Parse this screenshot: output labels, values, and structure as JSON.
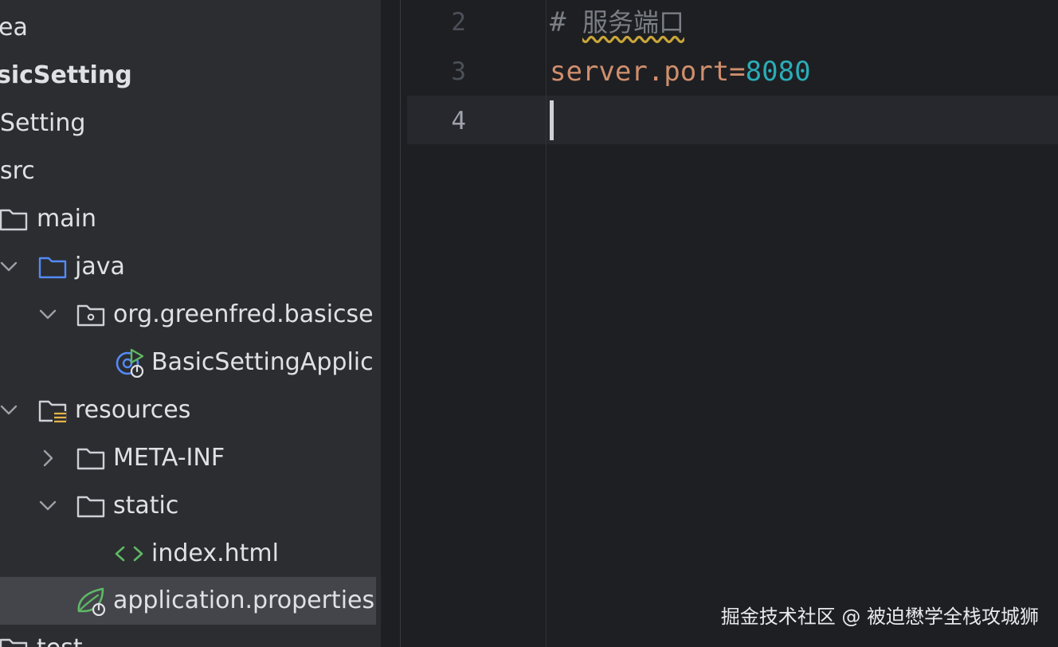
{
  "project_tree": {
    "items": [
      {
        "label": "ea"
      },
      {
        "label": "sicSetting"
      },
      {
        "label": "Setting"
      },
      {
        "label": "src"
      },
      {
        "label": "main"
      },
      {
        "label": "java"
      },
      {
        "label": "org.greenfred.basicse"
      },
      {
        "label": "BasicSettingApplic"
      },
      {
        "label": "resources"
      },
      {
        "label": "META-INF"
      },
      {
        "label": "static"
      },
      {
        "label": "index.html"
      },
      {
        "label": "application.properties"
      },
      {
        "label": "test"
      }
    ]
  },
  "editor": {
    "lines": [
      {
        "number": "2",
        "hash": "#",
        "comment": "服务端口"
      },
      {
        "number": "3",
        "key": "server.port",
        "eq": "=",
        "value": "8080"
      },
      {
        "number": "4"
      }
    ]
  },
  "watermark": "掘金技术社区 @ 被迫懋学全栈攻城狮",
  "colors": {
    "tree_bg": "#2b2d30",
    "editor_bg": "#1e1f22",
    "selection_bg": "#43454a",
    "current_line_bg": "#26282e",
    "comment": "#7a7e85",
    "property_key": "#cf8e6d",
    "number": "#2aacb8",
    "folder_icon": "#ced0d6",
    "source_folder_icon": "#548af7",
    "spring_icon": "#5fb865"
  }
}
